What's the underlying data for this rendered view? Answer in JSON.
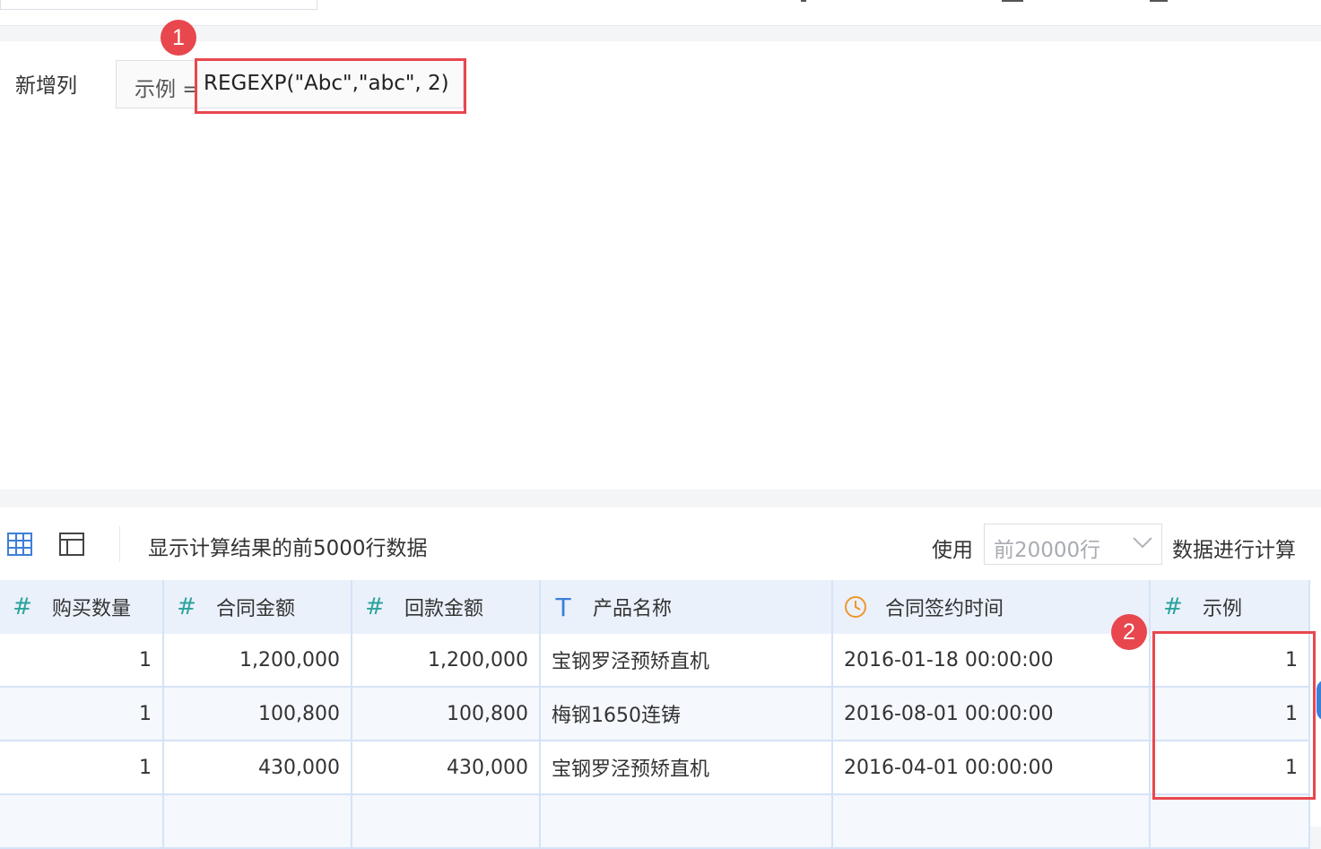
{
  "colors": {
    "accent": "#3c7fd8",
    "highlight": "#e8474e",
    "number_icon": "#2ba49c",
    "time_icon": "#f0962d",
    "header_bg": "#eaf1fb"
  },
  "badges": {
    "one": "1",
    "two": "2"
  },
  "editor": {
    "label": "新增列",
    "formula_prefix": "示例 =",
    "formula_expr": "REGEXP(\"Abc\",\"abc\", 2)"
  },
  "toolbar": {
    "grid_view_icon": "table-grid-icon",
    "panel_view_icon": "layout-panel-icon",
    "note": "显示计算结果的前5000行数据",
    "use_label": "使用",
    "rows_select": {
      "value": "前20000行"
    },
    "calc_label": "数据进行计算"
  },
  "table": {
    "columns": [
      {
        "label": "购买数量",
        "icon": "number-hash-icon",
        "glyph": "#"
      },
      {
        "label": "合同金额",
        "icon": "number-hash-icon",
        "glyph": "#"
      },
      {
        "label": "回款金额",
        "icon": "number-hash-icon",
        "glyph": "#"
      },
      {
        "label": "产品名称",
        "icon": "text-type-icon",
        "glyph": "T"
      },
      {
        "label": "合同签约时间",
        "icon": "clock-icon",
        "glyph": ""
      },
      {
        "label": "示例",
        "icon": "number-hash-icon",
        "glyph": "#"
      }
    ],
    "rows": [
      [
        "1",
        "1,200,000",
        "1,200,000",
        "宝钢罗泾预矫直机",
        "2016-01-18 00:00:00",
        "1"
      ],
      [
        "1",
        "100,800",
        "100,800",
        "梅钢1650连铸",
        "2016-08-01 00:00:00",
        "1"
      ],
      [
        "1",
        "430,000",
        "430,000",
        "宝钢罗泾预矫直机",
        "2016-04-01 00:00:00",
        "1"
      ],
      [
        "",
        "",
        "",
        "",
        "",
        ""
      ]
    ]
  }
}
